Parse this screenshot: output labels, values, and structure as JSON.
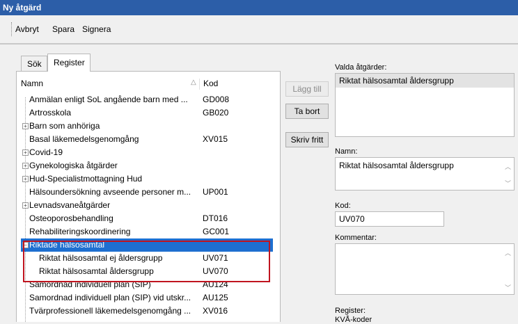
{
  "window": {
    "title": "Ny åtgärd"
  },
  "toolbar": {
    "cancel": "Avbryt",
    "save": "Spara",
    "sign": "Signera"
  },
  "tabs": [
    {
      "label": "Sök"
    },
    {
      "label": "Register"
    }
  ],
  "tree": {
    "col_name": "Namn",
    "col_code": "Kod",
    "sort_glyph": "△",
    "rows": [
      {
        "name": "Anmälan enligt SoL angående barn med ...",
        "code": "GD008"
      },
      {
        "name": "Artrosskola",
        "code": "GB020"
      },
      {
        "name": "Barn som anhöriga",
        "code": ""
      },
      {
        "name": "Basal läkemedelsgenomgång",
        "code": "XV015"
      },
      {
        "name": "Covid-19",
        "code": ""
      },
      {
        "name": "Gynekologiska åtgärder",
        "code": ""
      },
      {
        "name": "Hud-Specialistmottagning Hud",
        "code": ""
      },
      {
        "name": "Hälsoundersökning avseende personer m...",
        "code": "UP001"
      },
      {
        "name": "Levnadsvaneåtgärder",
        "code": ""
      },
      {
        "name": "Osteoporosbehandling",
        "code": "DT016"
      },
      {
        "name": "Rehabiliteringskoordinering",
        "code": "GC001"
      },
      {
        "name": "Riktade hälsosamtal",
        "code": ""
      },
      {
        "name": "Riktat hälsosamtal ej åldersgrupp",
        "code": "UV071"
      },
      {
        "name": "Riktat hälsosamtal åldersgrupp",
        "code": "UV070"
      },
      {
        "name": "Samordnad individuell plan (SIP)",
        "code": "AU124"
      },
      {
        "name": "Samordnad individuell plan (SIP) vid utskr...",
        "code": "AU125"
      },
      {
        "name": "Tvärprofessionell läkemedelsgenomgång ...",
        "code": "XV016"
      }
    ]
  },
  "buttons": {
    "add": "Lägg till",
    "remove": "Ta bort",
    "free": "Skriv fritt"
  },
  "right": {
    "selected_label": "Valda åtgärder:",
    "selected_items": [
      "Riktat hälsosamtal åldersgrupp"
    ],
    "name_label": "Namn:",
    "name_value": "Riktat hälsosamtal åldersgrupp",
    "code_label": "Kod:",
    "code_value": "UV070",
    "comment_label": "Kommentar:",
    "comment_value": "",
    "register_label": "Register:",
    "register_value": "KVÅ-koder"
  },
  "colors": {
    "titlebar": "#2c5ea8",
    "selection": "#1e6fd0",
    "highlight_border": "#c0141f"
  }
}
